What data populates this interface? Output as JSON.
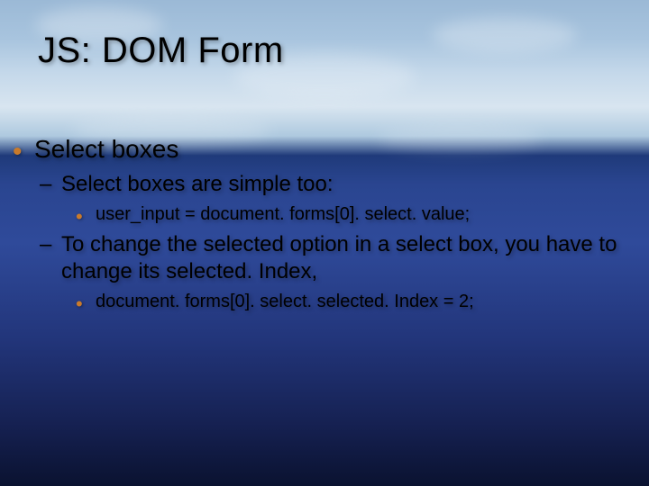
{
  "title": "JS: DOM Form",
  "bullets": {
    "l1": "Select boxes",
    "l2a": "Select boxes are simple too:",
    "l3a": "user_input = document. forms[0]. select. value;",
    "l2b": "To change the selected option in a select box, you have to change its selected. Index,",
    "l3b": "document. forms[0]. select. selected. Index = 2;"
  }
}
